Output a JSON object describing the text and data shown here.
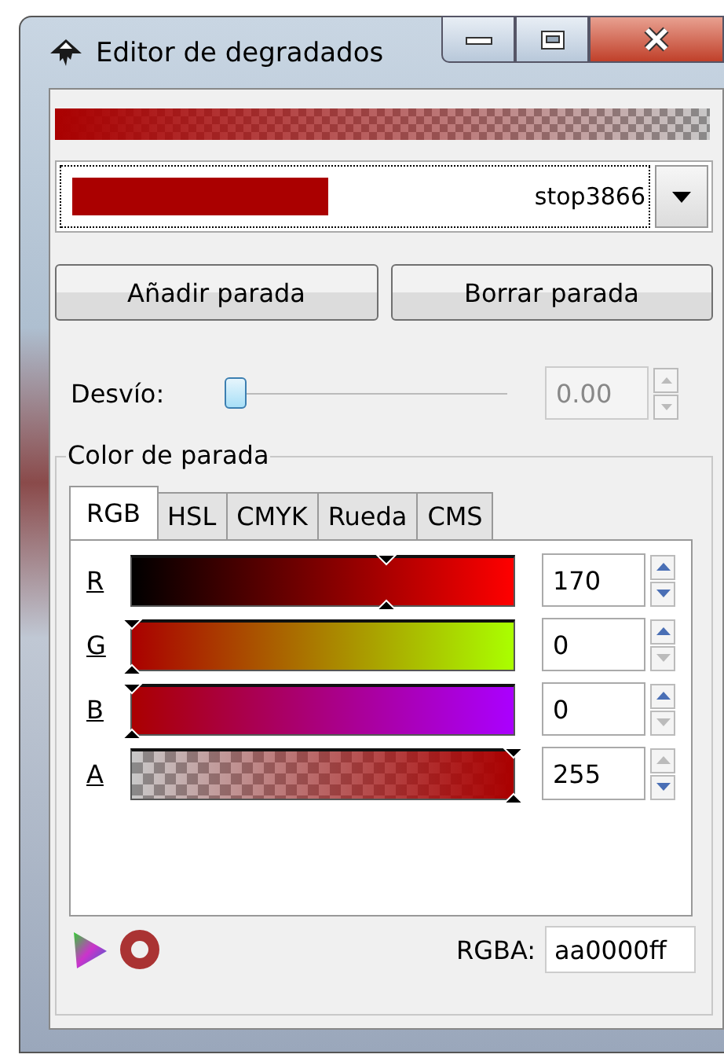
{
  "window": {
    "title": "Editor de degradados"
  },
  "stop_selector": {
    "value": "stop3866"
  },
  "buttons": [
    "Añadir parada",
    "Borrar parada"
  ],
  "offset": {
    "label": "Desvío:",
    "level": 0,
    "value": "0.00",
    "disabled": true
  },
  "stop_color": {
    "legend": "Color de parada",
    "tabs": [
      {
        "label": "RGB",
        "selected": true
      },
      {
        "label": "HSL",
        "selected": false
      },
      {
        "label": "CMYK",
        "selected": false
      },
      {
        "label": "Rueda",
        "selected": false
      },
      {
        "label": "CMS",
        "selected": false
      }
    ],
    "channels": [
      {
        "label": "R",
        "kind": "red",
        "level": 0.667,
        "value": "170",
        "up_enabled": true,
        "down_enabled": true
      },
      {
        "label": "G",
        "kind": "green",
        "level": 0,
        "value": "0",
        "up_enabled": true,
        "down_enabled": false
      },
      {
        "label": "B",
        "kind": "blue",
        "level": 0,
        "value": "0",
        "up_enabled": true,
        "down_enabled": false
      },
      {
        "label": "A",
        "kind": "alpha",
        "level": 1,
        "value": "255",
        "up_enabled": false,
        "down_enabled": true
      }
    ],
    "rgba": {
      "label": "RGBA:",
      "value": "aa0000ff"
    }
  }
}
